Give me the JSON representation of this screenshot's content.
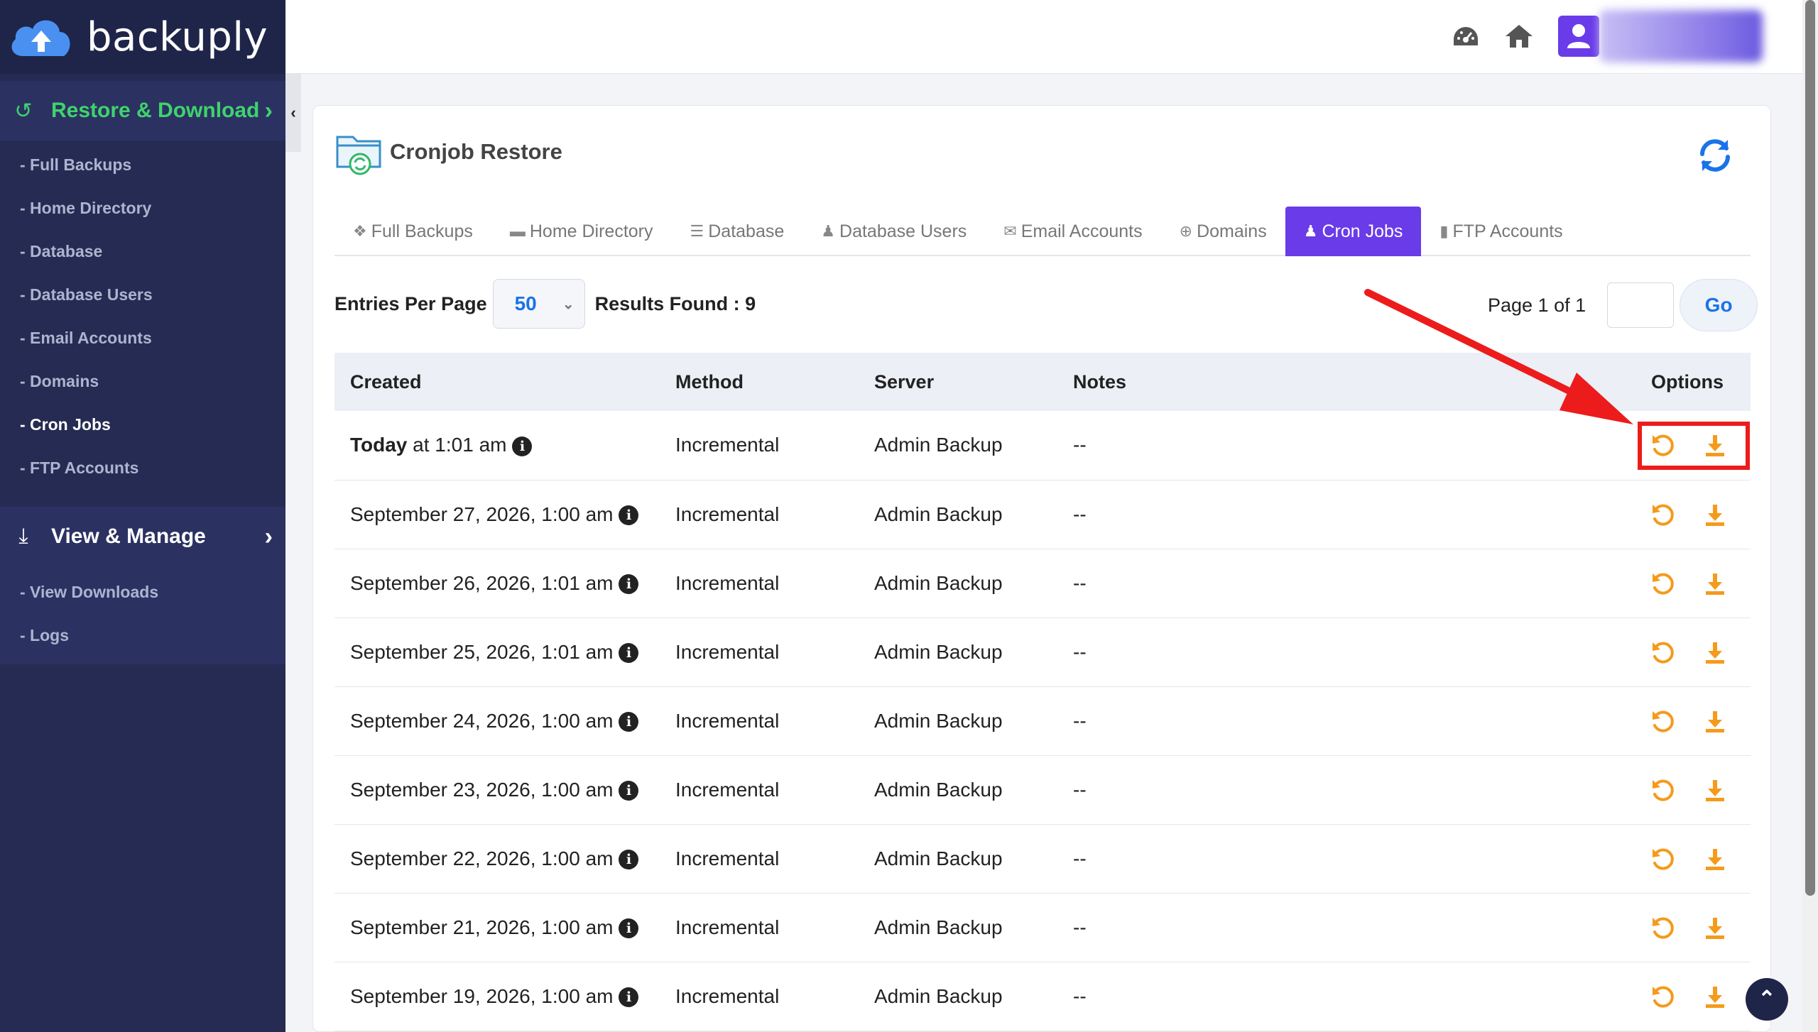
{
  "brand": {
    "name": "backuply"
  },
  "sidebar": {
    "restore_section": {
      "label": "Restore & Download",
      "icon": "undo-icon"
    },
    "restore_items": [
      {
        "label": "- Full Backups"
      },
      {
        "label": "- Home Directory"
      },
      {
        "label": "- Database"
      },
      {
        "label": "- Database Users"
      },
      {
        "label": "- Email Accounts"
      },
      {
        "label": "- Domains"
      },
      {
        "label": "- Cron Jobs",
        "active": true
      },
      {
        "label": "- FTP Accounts"
      }
    ],
    "manage_section": {
      "label": "View & Manage",
      "icon": "download-icon"
    },
    "manage_items": [
      {
        "label": "- View Downloads"
      },
      {
        "label": "- Logs"
      }
    ],
    "collapse_glyph": "‹"
  },
  "topbar": {
    "icons": [
      "dashboard-icon",
      "home-icon",
      "user-icon"
    ]
  },
  "card": {
    "title": "Cronjob Restore"
  },
  "tabs": [
    {
      "label": "Full Backups",
      "icon": "cubes-icon"
    },
    {
      "label": "Home Directory",
      "icon": "folder-icon"
    },
    {
      "label": "Database",
      "icon": "database-icon"
    },
    {
      "label": "Database Users",
      "icon": "user-icon"
    },
    {
      "label": "Email Accounts",
      "icon": "envelope-icon"
    },
    {
      "label": "Domains",
      "icon": "globe-icon"
    },
    {
      "label": "Cron Jobs",
      "icon": "user-clock-icon",
      "active": true
    },
    {
      "label": "FTP Accounts",
      "icon": "file-icon"
    }
  ],
  "controls": {
    "entries_label": "Entries Per Page",
    "entries_value": "50",
    "results_label": "Results Found : 9",
    "page_label": "Page 1 of 1",
    "page_input": "",
    "go_label": "Go"
  },
  "table": {
    "headers": [
      "Created",
      "Method",
      "Server",
      "Notes",
      "Options"
    ],
    "rows": [
      {
        "created_bold": "Today",
        "created": " at 1:01 am",
        "method": "Incremental",
        "server": "Admin Backup",
        "notes": "--"
      },
      {
        "created_bold": "",
        "created": "September 27, 2026, 1:00 am",
        "method": "Incremental",
        "server": "Admin Backup",
        "notes": "--"
      },
      {
        "created_bold": "",
        "created": "September 26, 2026, 1:01 am",
        "method": "Incremental",
        "server": "Admin Backup",
        "notes": "--"
      },
      {
        "created_bold": "",
        "created": "September 25, 2026, 1:01 am",
        "method": "Incremental",
        "server": "Admin Backup",
        "notes": "--"
      },
      {
        "created_bold": "",
        "created": "September 24, 2026, 1:00 am",
        "method": "Incremental",
        "server": "Admin Backup",
        "notes": "--"
      },
      {
        "created_bold": "",
        "created": "September 23, 2026, 1:00 am",
        "method": "Incremental",
        "server": "Admin Backup",
        "notes": "--"
      },
      {
        "created_bold": "",
        "created": "September 22, 2026, 1:00 am",
        "method": "Incremental",
        "server": "Admin Backup",
        "notes": "--"
      },
      {
        "created_bold": "",
        "created": "September 21, 2026, 1:00 am",
        "method": "Incremental",
        "server": "Admin Backup",
        "notes": "--"
      },
      {
        "created_bold": "",
        "created": "September 19, 2026, 1:00 am",
        "method": "Incremental",
        "server": "Admin Backup",
        "notes": "--"
      }
    ],
    "option_icons": [
      "restore-icon",
      "download-icon"
    ]
  },
  "colors": {
    "accent": "#6a3be8",
    "sidebar_bg": "#252b52",
    "restore_green": "#3fd36c",
    "option_orange": "#f59a1b",
    "annotation_red": "#ec1c1c",
    "link_blue": "#1a73e8"
  }
}
